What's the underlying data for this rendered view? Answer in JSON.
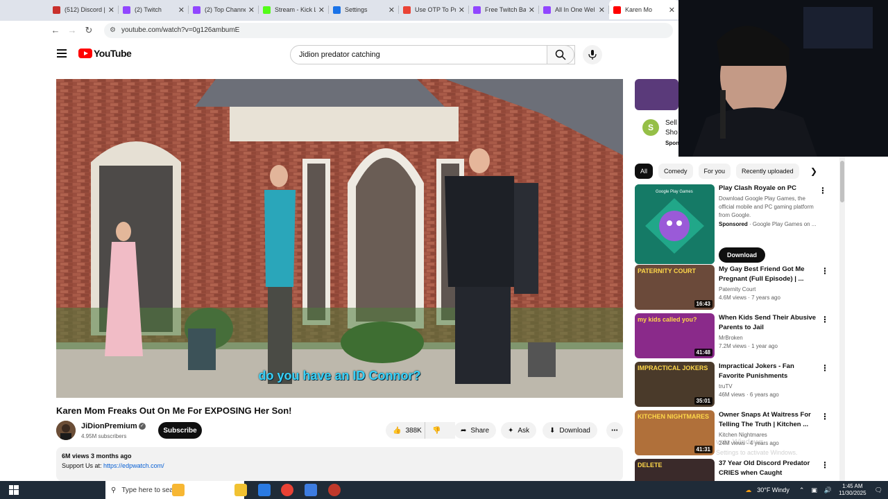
{
  "browser": {
    "tabs": [
      {
        "title": "(512) Discord |",
        "color": "#c9302c"
      },
      {
        "title": "(2) Twitch",
        "color": "#9146ff"
      },
      {
        "title": "(2) Top Channe",
        "color": "#9146ff"
      },
      {
        "title": "Stream - Kick L",
        "color": "#53fc18"
      },
      {
        "title": "Settings",
        "color": "#1a73e8"
      },
      {
        "title": "Use OTP To Pr",
        "color": "#ea4335"
      },
      {
        "title": "Free Twitch Ba",
        "color": "#9146ff"
      },
      {
        "title": "All In One Wel",
        "color": "#9146ff"
      },
      {
        "title": "Karen Mo",
        "color": "#ff0000"
      }
    ],
    "url": "youtube.com/watch?v=0g126ambumE"
  },
  "header": {
    "logo_text": "YouTube",
    "search_value": "Jidion predator catching"
  },
  "video": {
    "caption": "do you have an ID Connor?",
    "title": "Karen Mom Freaks Out On Me For EXPOSING Her Son!",
    "channel": "JiDionPremium",
    "subscribers": "4.95M subscribers",
    "subscribe_label": "Subscribe",
    "likes": "388K",
    "share_label": "Share",
    "ask_label": "Ask",
    "download_label": "Download",
    "views_date": "6M views  3 months ago",
    "support_text": "Support Us at:",
    "support_link": "https://edpwatch.com/"
  },
  "ad_card": {
    "line1": "Sell",
    "line2": "Sho",
    "line3": "Spon"
  },
  "chips": [
    "All",
    "Comedy",
    "For you",
    "Recently uploaded"
  ],
  "sponsored": {
    "title": "Play Clash Royale on PC",
    "desc": "Download Google Play Games, the official mobile and PC gaming platform from Google.",
    "sponsor_label": "Sponsored",
    "sponsor_by": " · Google Play Games on ...",
    "button": "Download",
    "thumb_badge": "Google Play Games"
  },
  "recommendations": [
    {
      "title": "My Gay Best Friend Got Me Pregnant (Full Episode) | ...",
      "channel": "Paternity Court",
      "meta": "4.6M views · 7 years ago",
      "duration": "16:43",
      "color": "#6b4a3a",
      "badge": "PATERNITY COURT"
    },
    {
      "title": "When Kids Send Their Abusive Parents to Jail",
      "channel": "MrBroken",
      "meta": "7.2M views · 1 year ago",
      "duration": "41:48",
      "color": "#8a2a8a",
      "badge": "my kids called you?"
    },
    {
      "title": "Impractical Jokers - Fan Favorite Punishments (Mashu...",
      "channel": "truTV",
      "meta": "46M views · 6 years ago",
      "duration": "35:01",
      "color": "#4a3a2a",
      "badge": "IMPRACTICAL JOKERS"
    },
    {
      "title": "Owner Snaps At Waitress For Telling The Truth | Kitchen ...",
      "channel": "Kitchen Nightmares",
      "meta": "24M views · 4 years ago",
      "duration": "41:31",
      "color": "#b0703a",
      "badge": "KITCHEN NIGHTMARES"
    },
    {
      "title": "37 Year Old Discord Predator CRIES when Caught",
      "channel": "",
      "meta": "",
      "duration": "",
      "color": "#3a2a2a",
      "badge": "DELETE"
    }
  ],
  "taskbar": {
    "search_placeholder": "Type here to search",
    "weather": "30°F  Windy",
    "time": "1:45 AM",
    "date": "11/30/2025"
  },
  "watermark": {
    "line1": "vate Windows",
    "line2": "Settings to activate Windows."
  }
}
